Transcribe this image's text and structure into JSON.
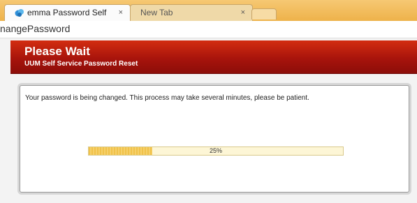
{
  "browser": {
    "tabs": [
      {
        "title": "emma Password Self",
        "close": "×",
        "active": true
      },
      {
        "title": "New Tab",
        "close": "×",
        "active": false
      }
    ],
    "url": "nangePassword"
  },
  "page": {
    "banner_title": "Please Wait",
    "banner_subtitle": "UUM Self Service Password Reset",
    "message": "Your password is being changed. This process may take several minutes, please be patient.",
    "progress": {
      "percent": 25,
      "label": "25%"
    }
  },
  "colors": {
    "banner": "#b3180d",
    "tabstrip": "#f0b54e",
    "progress_fill": "#f0c24a",
    "progress_track": "#fdf6d6"
  }
}
